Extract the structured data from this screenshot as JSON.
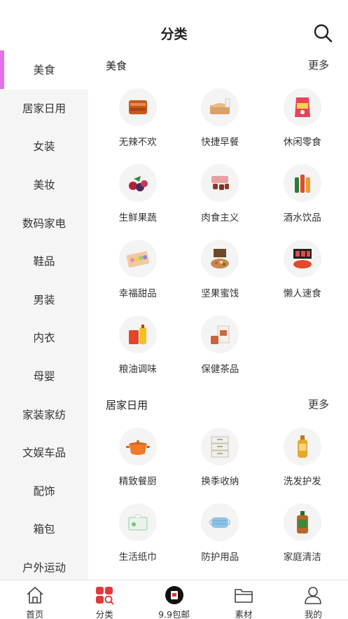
{
  "header": {
    "title": "分类"
  },
  "sidebar": {
    "items": [
      {
        "label": "美食"
      },
      {
        "label": "居家日用"
      },
      {
        "label": "女装"
      },
      {
        "label": "美妆"
      },
      {
        "label": "数码家电"
      },
      {
        "label": "鞋品"
      },
      {
        "label": "男装"
      },
      {
        "label": "内衣"
      },
      {
        "label": "母婴"
      },
      {
        "label": "家装家纺"
      },
      {
        "label": "文娱车品"
      },
      {
        "label": "配饰"
      },
      {
        "label": "箱包"
      },
      {
        "label": "户外运动"
      }
    ],
    "active_index": 0
  },
  "sections": [
    {
      "title": "美食",
      "more": "更多",
      "items": [
        {
          "label": "无辣不欢",
          "icon": "spicy-snack-icon"
        },
        {
          "label": "快捷早餐",
          "icon": "bread-icon"
        },
        {
          "label": "休闲零食",
          "icon": "chips-bag-icon"
        },
        {
          "label": "生鲜果蔬",
          "icon": "berries-icon"
        },
        {
          "label": "肉食主义",
          "icon": "meat-icon"
        },
        {
          "label": "酒水饮品",
          "icon": "bottles-icon"
        },
        {
          "label": "幸福甜品",
          "icon": "macaron-box-icon"
        },
        {
          "label": "坚果蜜饯",
          "icon": "nut-box-icon"
        },
        {
          "label": "懒人速食",
          "icon": "instant-noodle-icon"
        },
        {
          "label": "粮油调味",
          "icon": "rice-oil-icon"
        },
        {
          "label": "保健茶品",
          "icon": "tea-icon"
        }
      ]
    },
    {
      "title": "居家日用",
      "more": "更多",
      "items": [
        {
          "label": "精致餐厨",
          "icon": "pot-icon"
        },
        {
          "label": "换季收纳",
          "icon": "storage-drawer-icon"
        },
        {
          "label": "洗发护发",
          "icon": "shampoo-icon"
        },
        {
          "label": "生活纸巾",
          "icon": "tissue-icon"
        },
        {
          "label": "防护用品",
          "icon": "mask-icon"
        },
        {
          "label": "家庭清洁",
          "icon": "cleaner-bottle-icon"
        }
      ]
    }
  ],
  "tabbar": {
    "items": [
      {
        "label": "首页",
        "icon": "home-icon"
      },
      {
        "label": "分类",
        "icon": "category-icon"
      },
      {
        "label": "9.9包邮",
        "icon": "free-shipping-icon"
      },
      {
        "label": "素材",
        "icon": "folder-icon"
      },
      {
        "label": "我的",
        "icon": "user-icon"
      }
    ]
  },
  "colors": {
    "accent": "#e272e6",
    "category_tab": "#e23a3a"
  }
}
